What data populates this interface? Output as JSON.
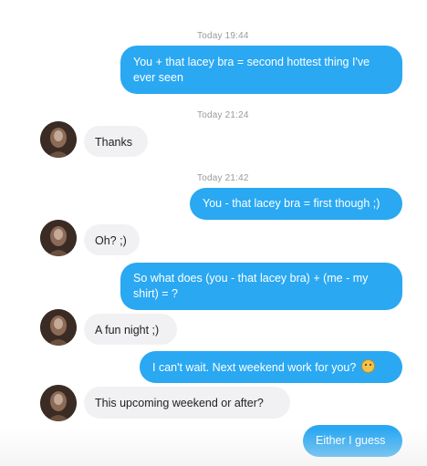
{
  "conversation": {
    "timestamps": {
      "t1": "Today 19:44",
      "t2": "Today 21:24",
      "t3": "Today 21:42"
    },
    "messages": {
      "m1": {
        "direction": "outgoing",
        "line1": "You + that lacey bra = second hottest thing I've",
        "line2": "ever seen"
      },
      "m2": {
        "direction": "incoming",
        "text": "Thanks"
      },
      "m3": {
        "direction": "outgoing",
        "text": "You - that lacey bra = first though ;)"
      },
      "m4": {
        "direction": "incoming",
        "text": "Oh? ;)"
      },
      "m5": {
        "direction": "outgoing",
        "line1": "So what does (you - that lacey bra) + (me - my",
        "line2": "shirt) = ?"
      },
      "m6": {
        "direction": "incoming",
        "text": "A fun night ;)"
      },
      "m7": {
        "direction": "outgoing",
        "text": "I can't wait. Next weekend work for you?",
        "emoji": "grinning-face-emoji"
      },
      "m8": {
        "direction": "incoming",
        "text": "This upcoming weekend or after?"
      },
      "m9": {
        "direction": "outgoing",
        "text": "Either I guess"
      }
    }
  },
  "colors": {
    "outgoing_bubble": "#2aa8f2",
    "incoming_bubble": "#f1f1f3",
    "timestamp": "#9a9a9a"
  },
  "icons": {
    "contact_avatar": "avatar-photo"
  }
}
